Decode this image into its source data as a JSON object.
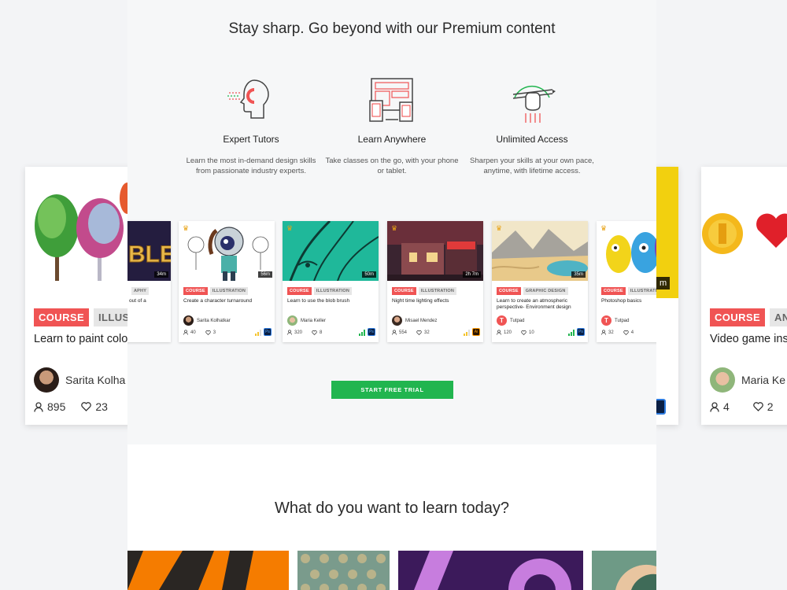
{
  "main": {
    "title": "Stay sharp. Go beyond with our Premium content",
    "features": [
      {
        "name": "Expert Tutors",
        "icon": "head-magnet-icon",
        "desc": "Learn the most in-demand design skills from passionate industry experts."
      },
      {
        "name": "Learn Anywhere",
        "icon": "devices-icon",
        "desc": "Take classes on the go, with your phone or tablet."
      },
      {
        "name": "Unlimited Access",
        "icon": "hand-pencil-icon",
        "desc": "Sharpen your skills at your own pace, anytime, with lifetime access."
      }
    ],
    "cta_label": "START FREE TRIAL",
    "learn_title": "What do you want to learn today?"
  },
  "cards": [
    {
      "duration": "34m",
      "tag1": "",
      "tag2": "APHY",
      "title": "out of a",
      "author": "",
      "learners": "",
      "likes": ""
    },
    {
      "duration": "56m",
      "tag1": "COURSE",
      "tag2": "ILLUSTRATION",
      "title": "Create a character turnaround",
      "author": "Sarita Kolhatkar",
      "learners": "40",
      "likes": "3"
    },
    {
      "duration": "50m",
      "tag1": "COURSE",
      "tag2": "ILLUSTRATION",
      "title": "Learn to use the blob brush",
      "author": "Maria Keller",
      "learners": "320",
      "likes": "8"
    },
    {
      "duration": "2h 7m",
      "tag1": "COURSE",
      "tag2": "ILLUSTRATION",
      "title": "Night time lighting effects",
      "author": "Misael Mendez",
      "learners": "554",
      "likes": "32"
    },
    {
      "duration": "35m",
      "tag1": "COURSE",
      "tag2": "GRAPHIC DESIGN",
      "title": "Learn to create an atmospheric perspective- Environment design",
      "author": "Tutpad",
      "learners": "120",
      "likes": "10"
    },
    {
      "duration": "",
      "tag1": "COURSE",
      "tag2": "ILLUSTRATI",
      "title": "Photoshop basics",
      "author": "Tutpad",
      "learners": "32",
      "likes": "4"
    }
  ],
  "bg_left": {
    "tag1": "COURSE",
    "tag2": "ILLUSTR",
    "title": "Learn to paint colo trees",
    "author": "Sarita Kolha",
    "learners": "895",
    "likes": "23"
  },
  "bg_yellow": {
    "duration": "m"
  },
  "bg_right": {
    "tag1": "COURSE",
    "tag2": "ANI",
    "title": "Video game ins",
    "author": "Maria Ke",
    "learners": "4",
    "likes": "2"
  },
  "colors": {
    "accent_red": "#f05454",
    "cta_green": "#21b54f",
    "tag_gray": "#e6e6e6",
    "crown": "#e8a317"
  }
}
